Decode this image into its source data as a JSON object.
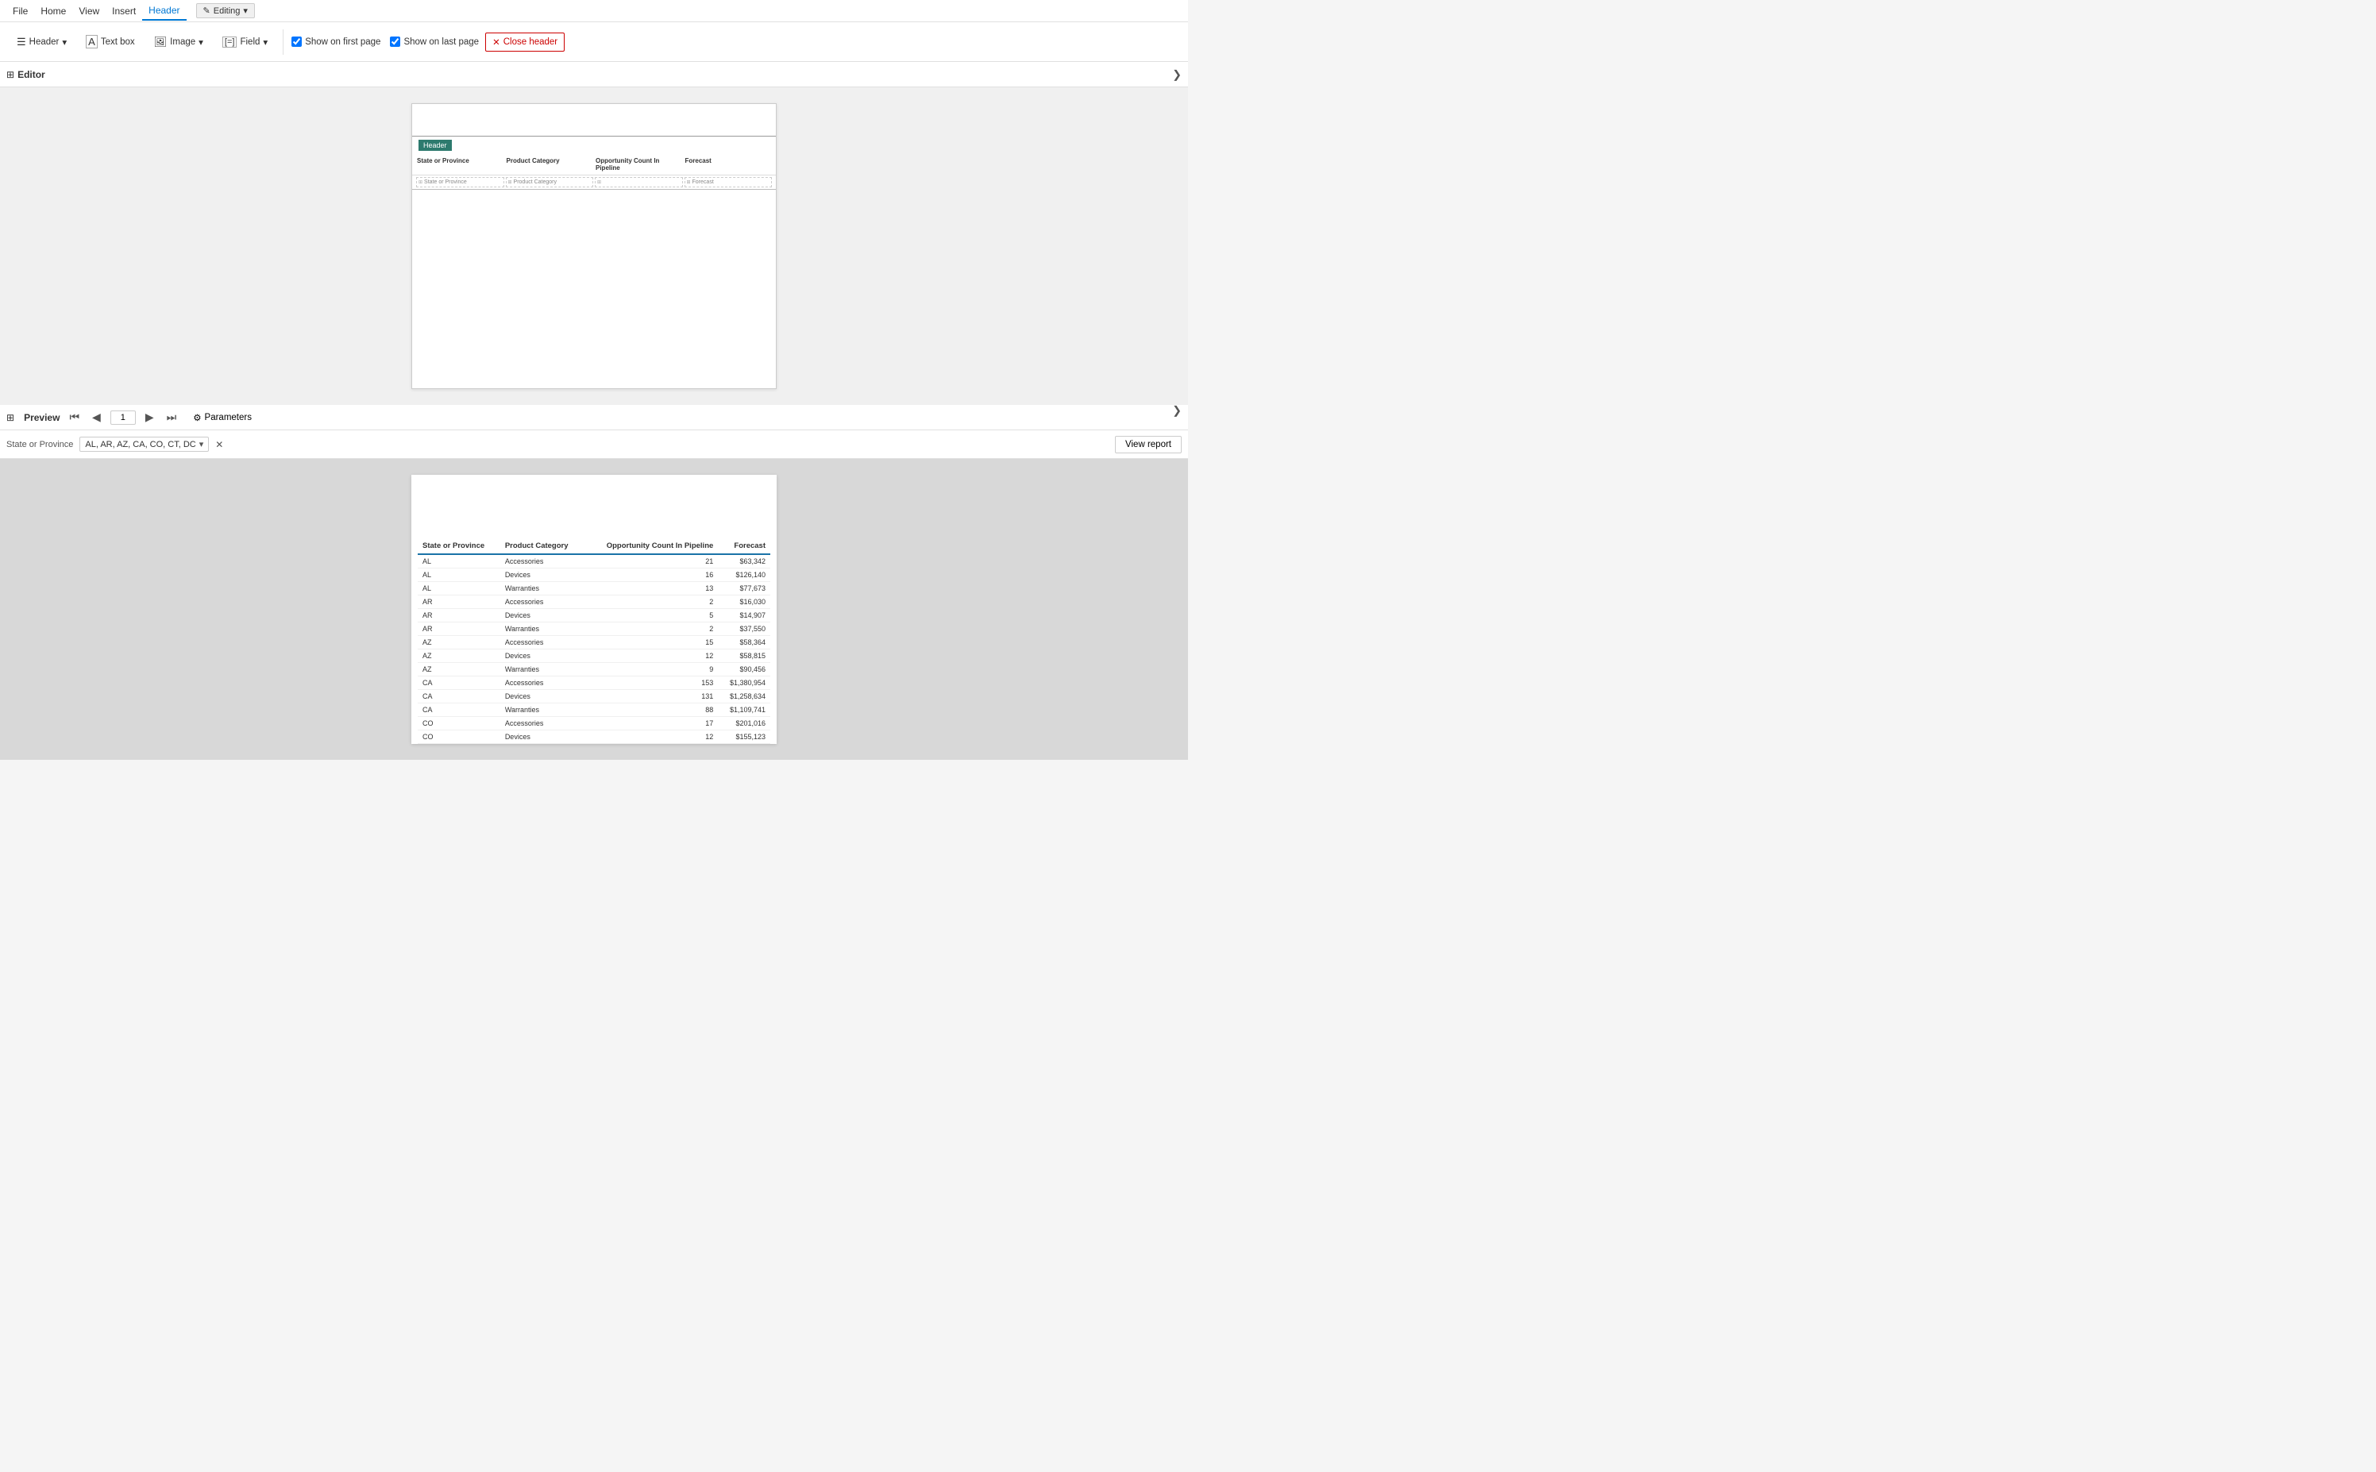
{
  "menubar": {
    "items": [
      "File",
      "Home",
      "View",
      "Insert",
      "Header"
    ]
  },
  "editing_badge": {
    "label": "Editing",
    "icon": "✎"
  },
  "ribbon": {
    "header_btn": "Header",
    "textbox_btn": "Text box",
    "image_btn": "Image",
    "field_btn": "Field",
    "show_first": "Show on first page",
    "show_last": "Show on last page",
    "close_header": "Close header",
    "show_first_checked": true,
    "show_last_checked": true
  },
  "editor": {
    "title": "Editor",
    "header_label": "Header",
    "columns": [
      "State or Province",
      "Product Category",
      "Opportunity Count In Pipeline",
      "Forecast"
    ],
    "placeholder_cells": [
      "State or Province",
      "Product Category",
      "",
      "Forecast"
    ]
  },
  "preview": {
    "title": "Preview",
    "page_number": "1",
    "parameters_label": "Parameters",
    "state_province_label": "State or Province",
    "state_province_value": "AL, AR, AZ, CA, CO, CT, DC",
    "view_report_btn": "View report"
  },
  "table": {
    "headers": [
      "State or Province",
      "Product Category",
      "Opportunity Count In Pipeline",
      "Forecast"
    ],
    "rows": [
      [
        "AL",
        "Accessories",
        "21",
        "$63,342"
      ],
      [
        "AL",
        "Devices",
        "16",
        "$126,140"
      ],
      [
        "AL",
        "Warranties",
        "13",
        "$77,673"
      ],
      [
        "AR",
        "Accessories",
        "2",
        "$16,030"
      ],
      [
        "AR",
        "Devices",
        "5",
        "$14,907"
      ],
      [
        "AR",
        "Warranties",
        "2",
        "$37,550"
      ],
      [
        "AZ",
        "Accessories",
        "15",
        "$58,364"
      ],
      [
        "AZ",
        "Devices",
        "12",
        "$58,815"
      ],
      [
        "AZ",
        "Warranties",
        "9",
        "$90,456"
      ],
      [
        "CA",
        "Accessories",
        "153",
        "$1,380,954"
      ],
      [
        "CA",
        "Devices",
        "131",
        "$1,258,634"
      ],
      [
        "CA",
        "Warranties",
        "88",
        "$1,109,741"
      ],
      [
        "CO",
        "Accessories",
        "17",
        "$201,016"
      ],
      [
        "CO",
        "Devices",
        "12",
        "$155,123"
      ]
    ]
  }
}
